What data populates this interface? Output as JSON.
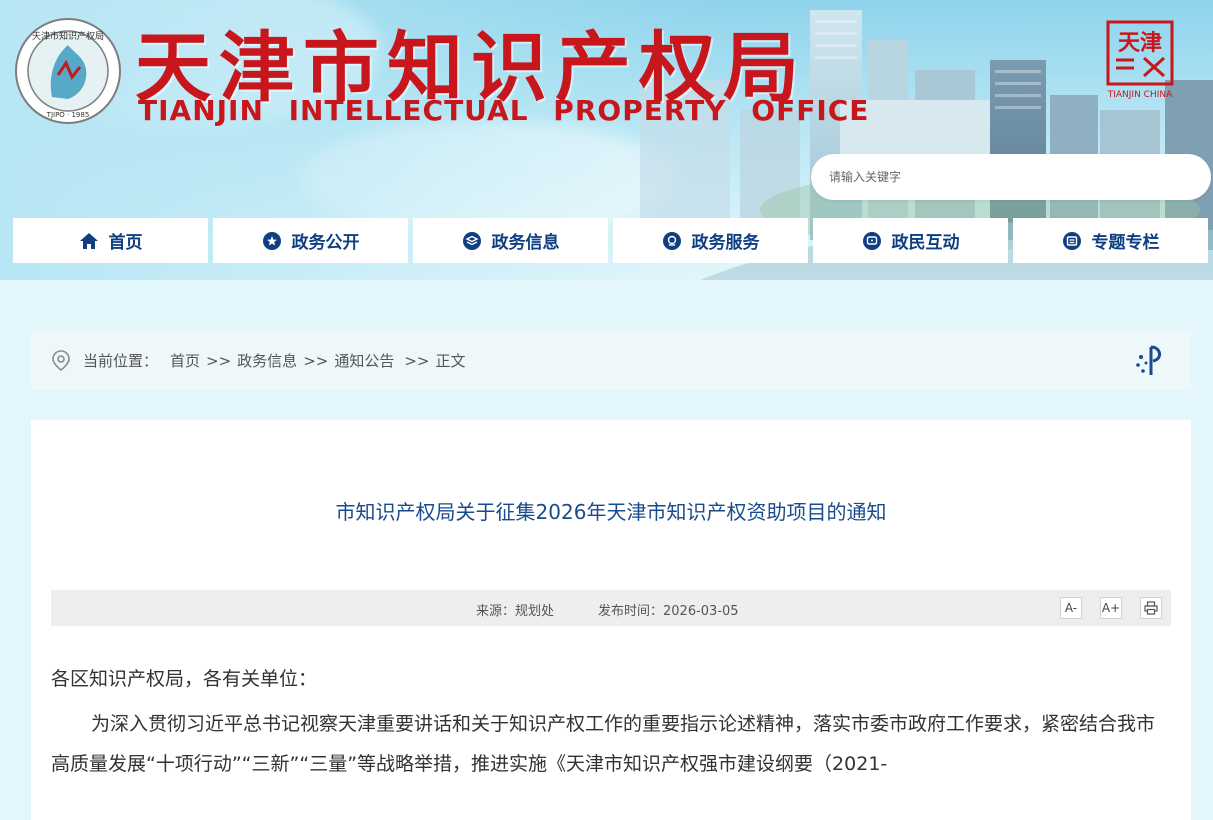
{
  "header": {
    "title_cn": "天津市知识产权局",
    "title_en": "TIANJIN INTELLECTUAL PROPERTY OFFICE",
    "logo_text": "天津市知识产权局 · TJIPO · 1985",
    "seal_text": "天津",
    "seal_caption": "TIANJIN CHINA",
    "brand_color": "#c8161d"
  },
  "search": {
    "placeholder": "请输入关键字"
  },
  "nav": {
    "items": [
      {
        "label": "首页",
        "icon": "home-icon"
      },
      {
        "label": "政务公开",
        "icon": "star-icon"
      },
      {
        "label": "政务信息",
        "icon": "layers-icon"
      },
      {
        "label": "政务服务",
        "icon": "badge-icon"
      },
      {
        "label": "政民互动",
        "icon": "chat-icon"
      },
      {
        "label": "专题专栏",
        "icon": "folder-icon"
      }
    ],
    "text_color": "#0f3f80"
  },
  "breadcrumb": {
    "label": "当前位置：",
    "items": [
      "首页",
      "政务信息",
      "通知公告",
      "正文"
    ],
    "separator": ">>"
  },
  "article": {
    "title": "市知识产权局关于征集2026年天津市知识产权资助项目的通知",
    "source": "来源：规划处",
    "publish_time": "发布时间：2026-03-05",
    "tools": {
      "font_smaller": "A-",
      "font_larger": "A+",
      "print": "print-icon"
    },
    "greeting": "各区知识产权局，各有关单位：",
    "paragraph": "为深入贯彻习近平总书记视察天津重要讲话和关于知识产权工作的重要指示论述精神，落实市委市政府工作要求，紧密结合我市高质量发展“十项行动”“三新”“三量”等战略举措，推进实施《天津市知识产权强市建设纲要（2021-"
  }
}
